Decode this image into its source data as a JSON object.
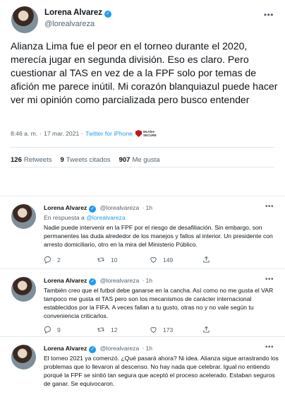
{
  "main_tweet": {
    "author": "Lorena Alvarez",
    "handle": "@lorealvareza",
    "text": "Alianza Lima fue el peor en el torneo durante el 2020, merecía jugar en segunda división. Eso es claro. Pero cuestionar al TAS en vez de a la FPF solo por temas de afición me parece inútil. Mi corazón blanquiazul puede hacer ver mi opinión como parcializada pero busco entender",
    "time": "8:46 a. m.",
    "date": "17 mar. 2021",
    "source": "Twitter for iPhone",
    "badge_line1": "McAfee",
    "badge_line2": "SECURE",
    "stats": {
      "retweets_count": "126",
      "retweets_label": "Retweets",
      "quotes_count": "9",
      "quotes_label": "Tweets citados",
      "likes_count": "907",
      "likes_label": "Me gusta"
    }
  },
  "replies": [
    {
      "author": "Lorena Alvarez",
      "handle": "@lorealvareza",
      "age": "1h",
      "replying_prefix": "En respuesta a",
      "replying_to": "@lorealvareza",
      "text": "Nadie puede intervenir en la FPF por el riesgo de desafiliación. Sin embargo, son permanentes las duda alrededor de los manejos y fallos al interior. Un presidente con arresto domiciliario, otro en la mira del Ministerio Público.",
      "replies": "2",
      "retweets": "10",
      "likes": "149"
    },
    {
      "author": "Lorena Alvarez",
      "handle": "@lorealvareza",
      "age": "1h",
      "text": "También creo que el futbol debe ganarse en la cancha. Así como no me gusta el VAR tampoco me gusta el TAS pero son los mecanismos de carácter internacional establecidos por la FIFA. A veces fallan a tu gusto, otras no y no vale según tu conveniencia criticarlos.",
      "replies": "9",
      "retweets": "12",
      "likes": "173"
    },
    {
      "author": "Lorena Alvarez",
      "handle": "@lorealvareza",
      "age": "1h",
      "text": "El torneo 2021 ya comenzó. ¿Qué pasará ahora? Ni idea. Alianza sigue arrastrando los problemas que lo llevaron al descenso. No hay nada que celebrar. Igual no entiendo porqué la FPF se sintió tan segura que aceptó el proceso acelerado. Estaban seguros de ganar. Se equivocaron."
    }
  ]
}
